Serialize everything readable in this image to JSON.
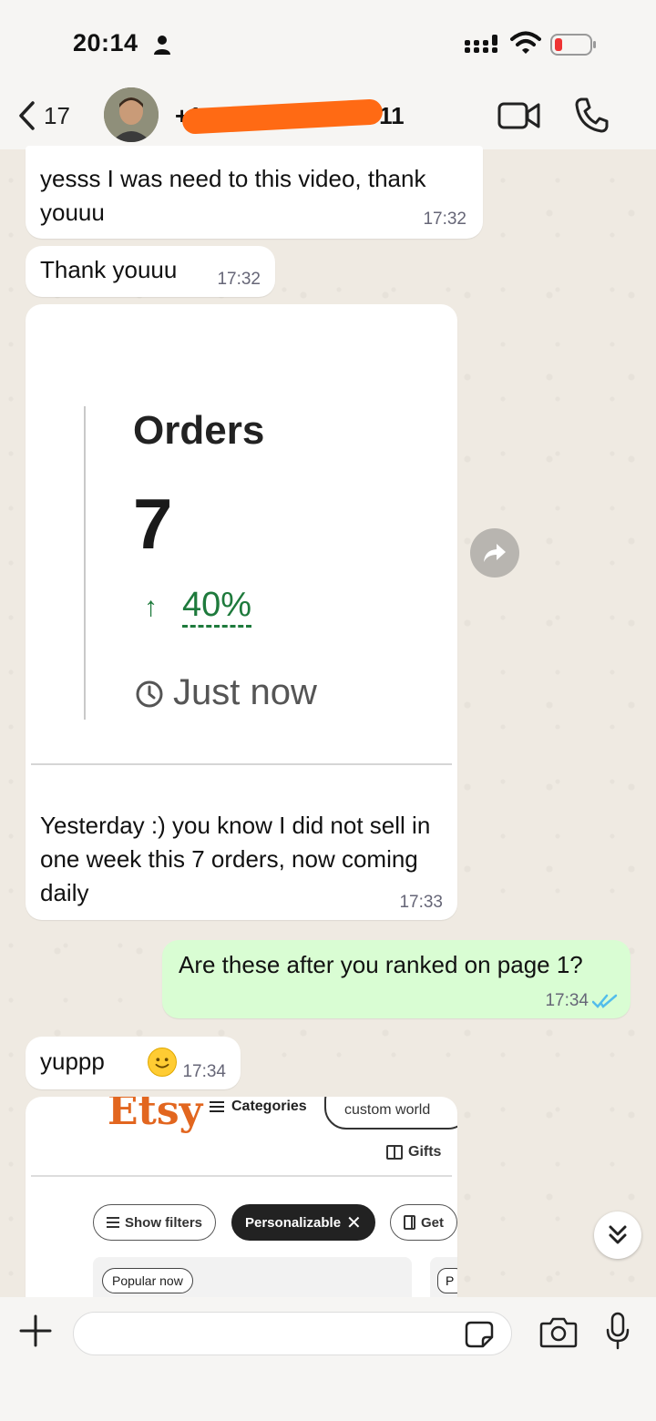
{
  "status_bar": {
    "time": "20:14"
  },
  "header": {
    "back_count": "17",
    "contact_name": "+1",
    "contact_name_tail": "011"
  },
  "messages": [
    {
      "direction": "in",
      "text": "yesss I was need to this video, thank youuu",
      "time": "17:32"
    },
    {
      "direction": "in",
      "text": "Thank youuu",
      "time": "17:32"
    },
    {
      "direction": "in",
      "image_card": {
        "title": "Orders",
        "value": "7",
        "change": "40%",
        "change_direction": "up",
        "when": "Just now"
      },
      "text": "Yesterday :) you know I did not sell in one week this 7 orders, now coming daily",
      "time": "17:33"
    },
    {
      "direction": "out",
      "text": "Are these after you ranked on page 1?",
      "time": "17:34",
      "status": "read"
    },
    {
      "direction": "in",
      "text": "yuppp",
      "emoji": "slightly-smiling-face",
      "time": "17:34"
    },
    {
      "direction": "in",
      "image_card": {
        "logo": "Etsy",
        "menu": "Categories",
        "search_value": "custom world",
        "gifts": "Gifts",
        "chips": [
          "Show filters",
          "Personalizable",
          "Get"
        ],
        "badges": [
          "Popular now",
          "P"
        ]
      }
    }
  ],
  "composer": {
    "placeholder": ""
  },
  "colors": {
    "outgoing_bubble": "#d9fdd3",
    "incoming_bubble": "#ffffff",
    "up_green": "#1e7a3c",
    "read_ticks": "#53bdeb",
    "etsy_orange": "#e2661f"
  },
  "icons": [
    "person-icon",
    "signal-icon",
    "wifi-icon",
    "battery-icon",
    "back-chevron-icon",
    "video-call-icon",
    "phone-icon",
    "forward-icon",
    "clock-icon",
    "double-check-icon",
    "chevrons-down-icon",
    "plus-icon",
    "sticker-icon",
    "camera-icon",
    "mic-icon"
  ]
}
